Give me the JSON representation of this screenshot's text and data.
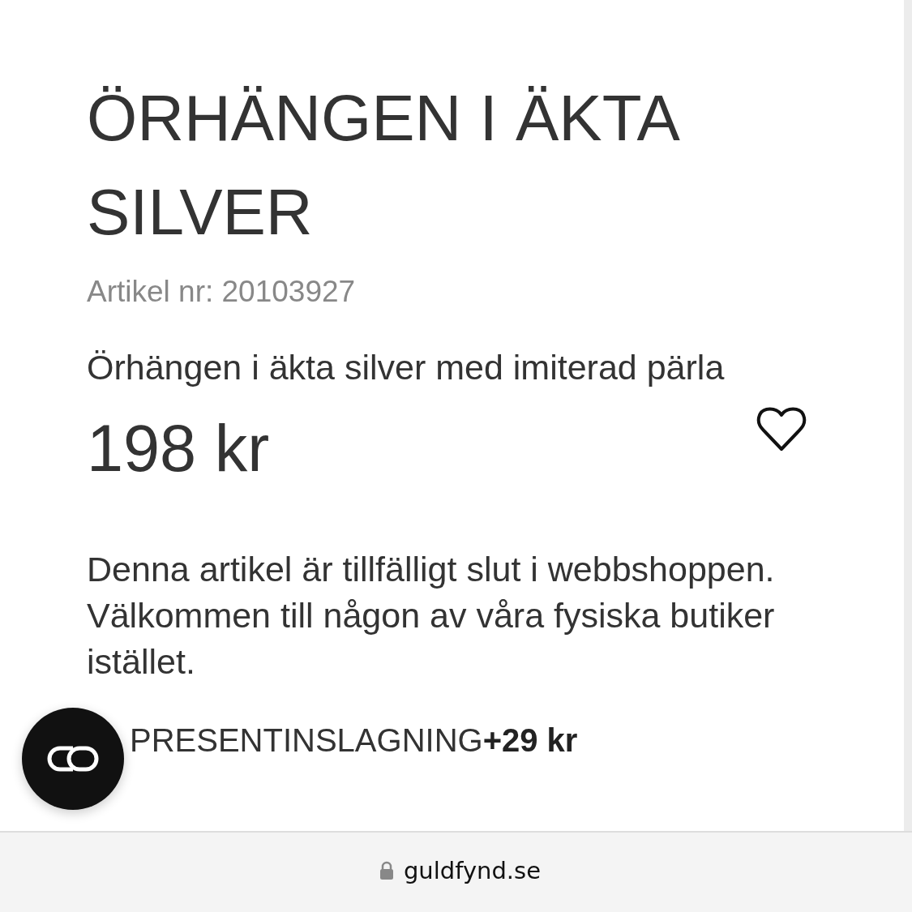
{
  "product": {
    "title": "ÖRHÄNGEN I ÄKTA SILVER",
    "article_number": "Artikel nr: 20103927",
    "description": "Örhängen i äkta silver med imiterad pärla",
    "price": "198 kr",
    "favorited": false,
    "stock_notice": "Denna artikel är tillfälligt slut i webbshoppen. Välkommen till någon av våra fysiska butiker istället.",
    "gift_wrap": "PRESENTINSLAGNING**+29 kr**"
  },
  "address_bar": {
    "url": "guldfynd.se"
  }
}
